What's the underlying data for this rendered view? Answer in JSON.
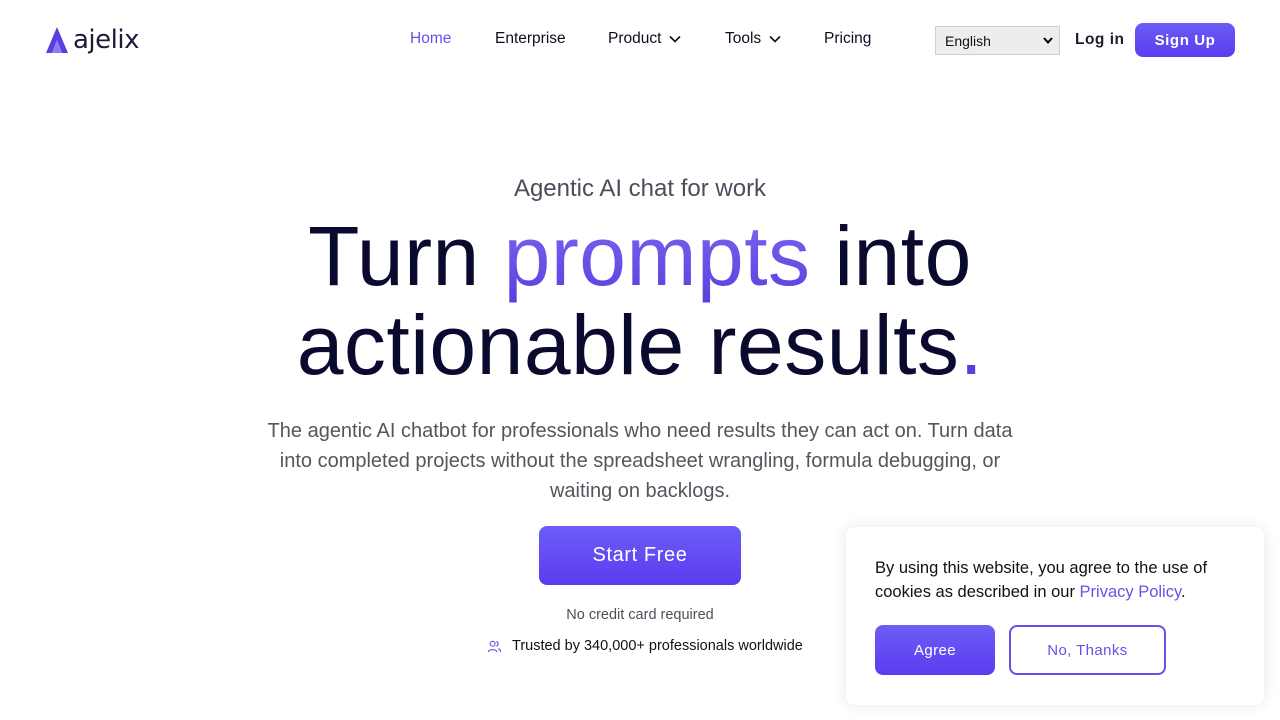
{
  "brand": {
    "name": "ajelix",
    "accent_color": "#5b3ee0",
    "logo_icon": "triangle-logo-icon"
  },
  "nav": {
    "items": [
      {
        "label": "Home",
        "active": true
      },
      {
        "label": "Enterprise"
      },
      {
        "label": "Product",
        "icon": "chevron-down-icon"
      },
      {
        "label": "Tools",
        "icon": "chevron-down-icon"
      },
      {
        "label": "Pricing"
      }
    ],
    "language_selected": "English",
    "login_label": "Log in",
    "signup_label": "Sign Up"
  },
  "hero": {
    "eyebrow": "Agentic AI chat for work",
    "headline_part1": "Turn ",
    "headline_accent": "prompts",
    "headline_part2": " into",
    "headline_line2": "actionable results",
    "headline_dot": ".",
    "subtext": "The agentic AI chatbot for professionals who need results they can act on. Turn data into completed projects without the spreadsheet wrangling, formula debugging, or waiting on backlogs.",
    "cta_label": "Start Free",
    "no_cc": "No credit card required",
    "trusted": "Trusted by 340,000+ professionals worldwide",
    "trusted_icon": "users-icon"
  },
  "cookie": {
    "text_before": "By using this website, you agree to the use of cookies as described in our ",
    "link": "Privacy Policy",
    "text_after": ".",
    "agree_label": "Agree",
    "decline_label": "No, Thanks"
  }
}
